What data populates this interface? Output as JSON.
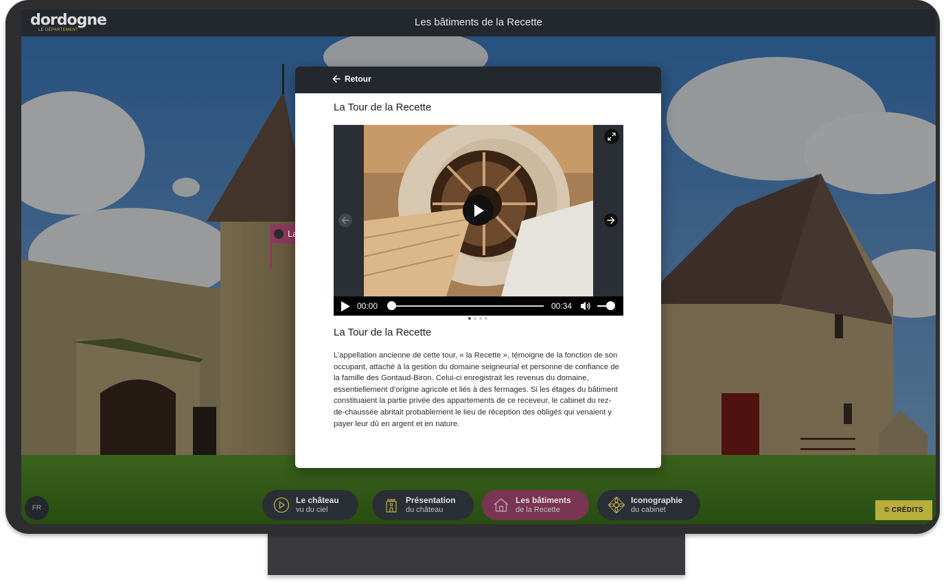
{
  "header": {
    "logo_word": "dordogne",
    "logo_sub": "LE DÉPARTEMENT",
    "title": "Les bâtiments de la Recette"
  },
  "hotspot": {
    "label_letter": "La"
  },
  "modal": {
    "back_label": "Retour",
    "title": "La Tour de la Recette",
    "video": {
      "current_time": "00:00",
      "duration": "00:34",
      "progress": 0,
      "volume": 0.8,
      "slide_count": 4,
      "active_slide": 1
    },
    "section_title": "La Tour de la Recette",
    "body": "L’appellation ancienne de cette tour, « la Recette », témoigne de la fonction de son occupant, attaché à la gestion du domaine seigneurial et personne de confiance de la famille des Gontaud-Biron. Celui-ci enregistrait les revenus du domaine, essentiellement d’origine agricole et liés à des fermages. Si les étages du bâtiment constituaient la partie privée des appartements de ce receveur, le cabinet du rez-de-chaussée abritait probablement le lieu de réception des obligés qui venaient y payer leur dû en argent et en nature."
  },
  "language": "FR",
  "nav": [
    {
      "line1": "Le château",
      "line2": "vu du ciel",
      "icon": "play-circle-icon",
      "active": false
    },
    {
      "line1": "Présentation",
      "line2": "du château",
      "icon": "tower-icon",
      "active": false
    },
    {
      "line1": "Les bâtiments",
      "line2": "de la Recette",
      "icon": "house-icon",
      "active": true
    },
    {
      "line1": "Iconographie",
      "line2": "du cabinet",
      "icon": "ornament-icon",
      "active": false
    }
  ],
  "credits_label": "© CRÉDITS",
  "colors": {
    "bar": "#23272e",
    "active_tab": "#7a3553",
    "credits": "#b9ad3c",
    "accent_gold": "#c9b84a"
  }
}
